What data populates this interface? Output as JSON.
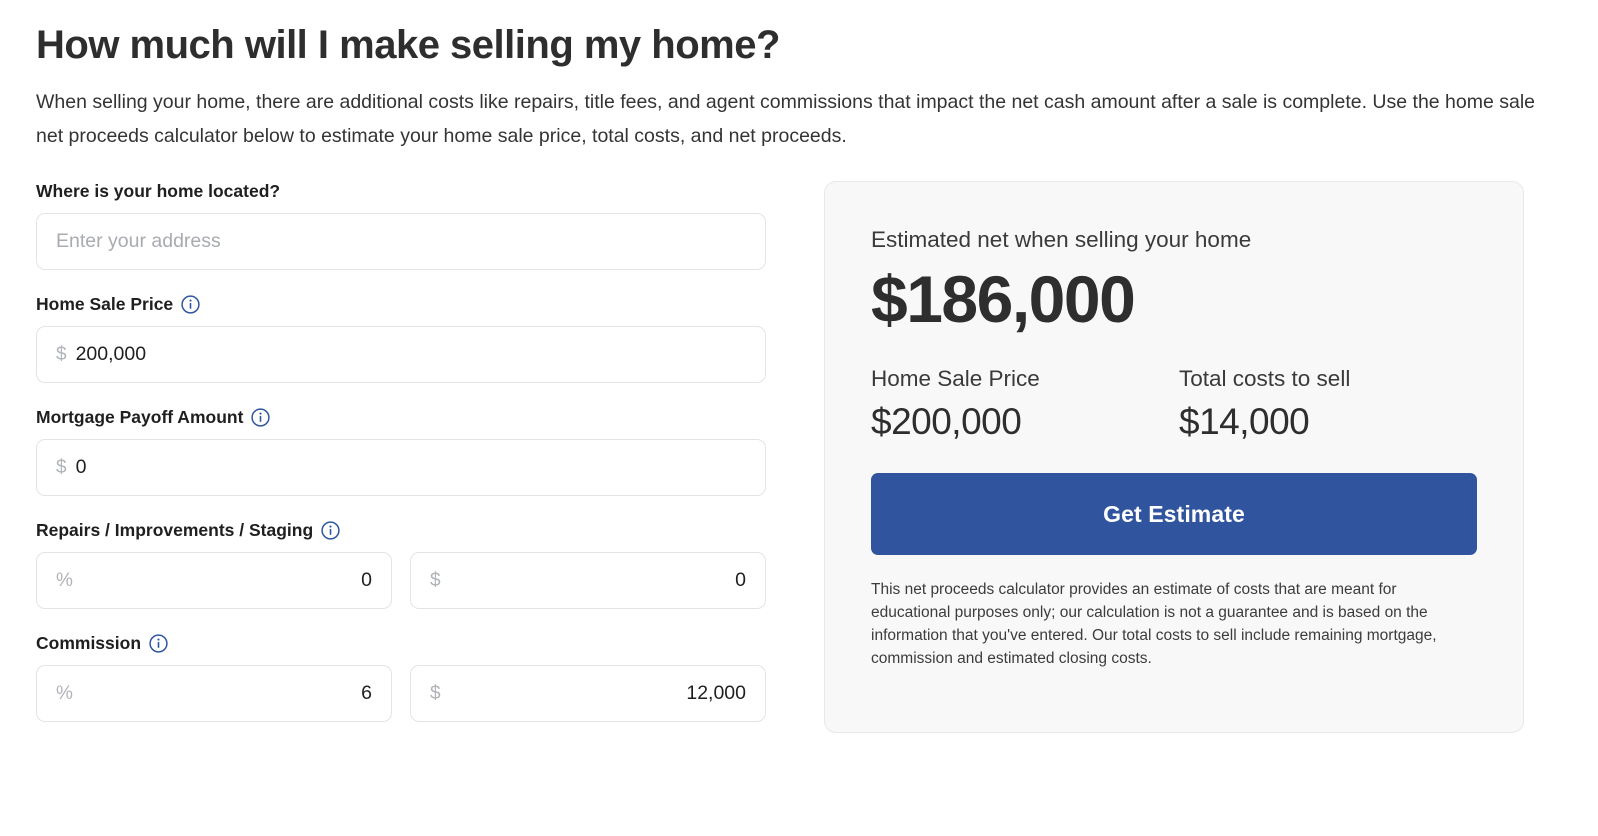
{
  "header": {
    "title": "How much will I make selling my home?",
    "subtitle": "When selling your home, there are additional costs like repairs, title fees, and agent commissions that impact the net cash amount after a sale is complete. Use the home sale net proceeds calculator below to estimate your home sale price, total costs, and net proceeds."
  },
  "form": {
    "address": {
      "label": "Where is your home located?",
      "placeholder": "Enter your address",
      "value": ""
    },
    "home_sale_price": {
      "label": "Home Sale Price",
      "info_icon": "info-icon",
      "prefix": "$",
      "value": "200,000"
    },
    "mortgage_payoff": {
      "label": "Mortgage Payoff Amount",
      "info_icon": "info-icon",
      "prefix": "$",
      "value": "0"
    },
    "repairs": {
      "label": "Repairs / Improvements / Staging",
      "info_icon": "info-icon",
      "percent_prefix": "%",
      "percent_value": "0",
      "dollar_prefix": "$",
      "dollar_value": "0"
    },
    "commission": {
      "label": "Commission",
      "info_icon": "info-icon",
      "percent_prefix": "%",
      "percent_value": "6",
      "dollar_prefix": "$",
      "dollar_value": "12,000"
    }
  },
  "result": {
    "eyebrow": "Estimated net when selling your home",
    "net_amount": "$186,000",
    "stats": [
      {
        "label": "Home Sale Price",
        "value": "$200,000"
      },
      {
        "label": "Total costs to sell",
        "value": "$14,000"
      }
    ],
    "cta_label": "Get Estimate",
    "disclaimer": "This net proceeds calculator provides an estimate of costs that are meant for educational purposes only; our calculation is not a guarantee and is based on the information that you've entered. Our total costs to sell include remaining mortgage, commission and estimated closing costs."
  },
  "colors": {
    "accent_blue": "#30559e",
    "info_icon_blue": "#2f56a0",
    "card_background": "#f8f8f9",
    "card_border": "#e7e8ea",
    "input_border": "#e2e4e7",
    "placeholder_gray": "#a8abaf",
    "text_dark": "#2e2e2e"
  }
}
